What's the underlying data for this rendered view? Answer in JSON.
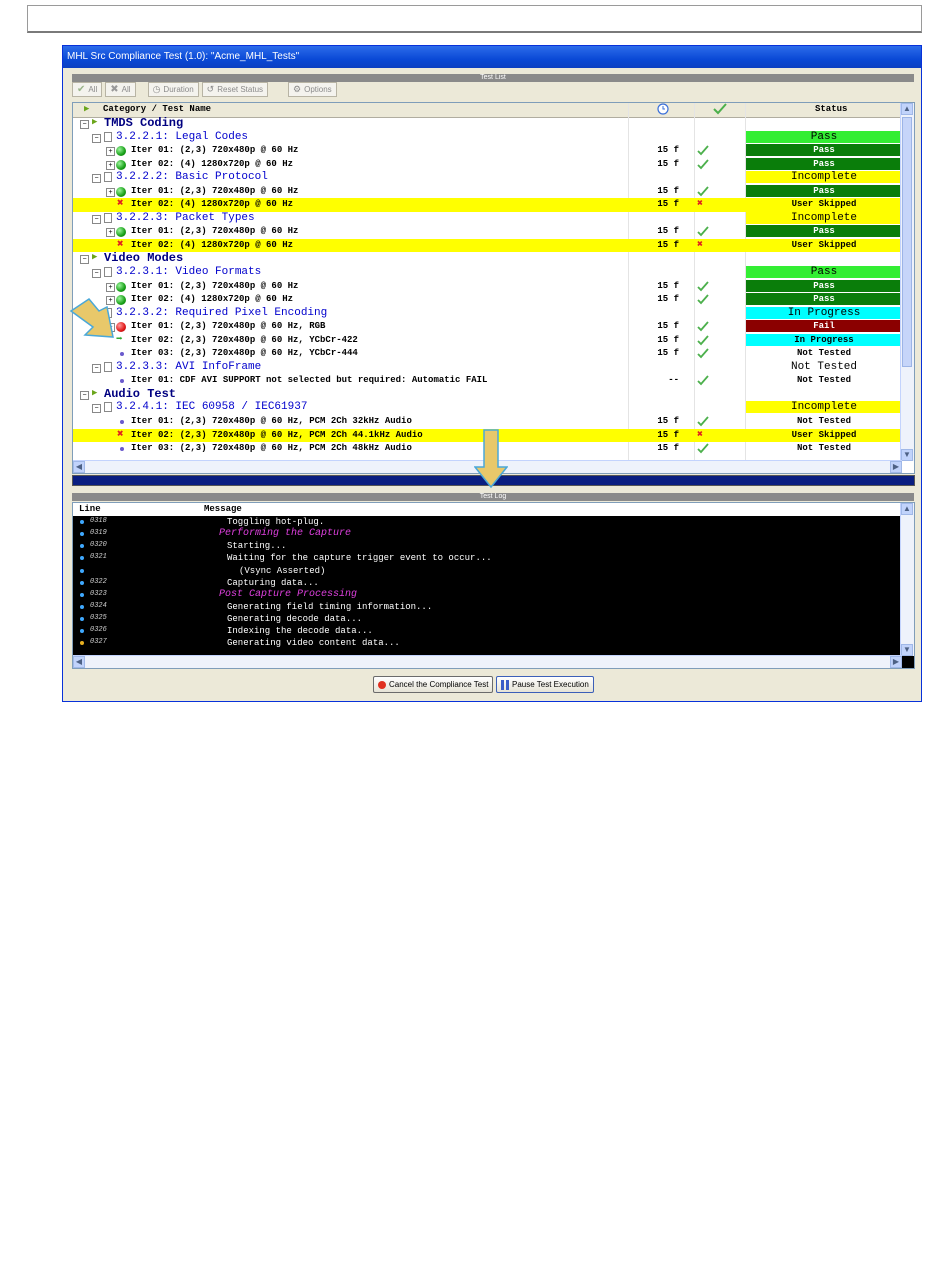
{
  "window": {
    "title": "MHL Src Compliance Test (1.0): \"Acme_MHL_Tests\"",
    "test_list_label": "Test List",
    "test_log_label": "Test Log"
  },
  "toolbar": {
    "check_all": "All",
    "uncheck_all": "All",
    "duration": "Duration",
    "reset_status": "Reset Status",
    "options": "Options"
  },
  "tree": {
    "header": {
      "name": "Category / Test Name",
      "status": "Status"
    },
    "rows": [
      {
        "kind": "cat",
        "name": "TMDS Coding",
        "dur": "",
        "check": "",
        "status": "",
        "status_color": "",
        "hl": false
      },
      {
        "kind": "grp",
        "name": "3.2.2.1: Legal Codes",
        "dur": "",
        "check": "",
        "status": "Pass",
        "status_color": "#33ee33",
        "hl": false
      },
      {
        "kind": "iter",
        "icon": "green",
        "name": "Iter 01: (2,3) 720x480p @ 60 Hz",
        "dur": "15 f",
        "check": "ok",
        "status": "Pass",
        "status_color": "#0a7d0a",
        "hl": false
      },
      {
        "kind": "iter",
        "icon": "green",
        "name": "Iter 02: (4) 1280x720p @ 60 Hz",
        "dur": "15 f",
        "check": "ok",
        "status": "Pass",
        "status_color": "#0a7d0a",
        "hl": false
      },
      {
        "kind": "grp",
        "name": "3.2.2.2: Basic Protocol",
        "dur": "",
        "check": "",
        "status": "Incomplete",
        "status_color": "#ffff00",
        "hl": false
      },
      {
        "kind": "iter",
        "icon": "green",
        "name": "Iter 01: (2,3) 720x480p @ 60 Hz",
        "dur": "15 f",
        "check": "ok",
        "status": "Pass",
        "status_color": "#0a7d0a",
        "hl": false
      },
      {
        "kind": "iter",
        "icon": "x",
        "name": "Iter 02: (4) 1280x720p @ 60 Hz",
        "dur": "15 f",
        "check": "x",
        "status": "User Skipped",
        "status_color": "#ffff00",
        "hl": true
      },
      {
        "kind": "grp",
        "name": "3.2.2.3: Packet Types",
        "dur": "",
        "check": "",
        "status": "Incomplete",
        "status_color": "#ffff00",
        "hl": false
      },
      {
        "kind": "iter",
        "icon": "green",
        "name": "Iter 01: (2,3) 720x480p @ 60 Hz",
        "dur": "15 f",
        "check": "ok",
        "status": "Pass",
        "status_color": "#0a7d0a",
        "hl": false
      },
      {
        "kind": "iter",
        "icon": "x",
        "name": "Iter 02: (4) 1280x720p @ 60 Hz",
        "dur": "15 f",
        "check": "x",
        "status": "User Skipped",
        "status_color": "#ffff00",
        "hl": true
      },
      {
        "kind": "cat",
        "name": "Video Modes",
        "dur": "",
        "check": "",
        "status": "",
        "status_color": "",
        "hl": false
      },
      {
        "kind": "grp",
        "name": "3.2.3.1: Video Formats",
        "dur": "",
        "check": "",
        "status": "Pass",
        "status_color": "#33ee33",
        "hl": false
      },
      {
        "kind": "iter",
        "icon": "green",
        "name": "Iter 01: (2,3) 720x480p @ 60 Hz",
        "dur": "15 f",
        "check": "ok",
        "status": "Pass",
        "status_color": "#0a7d0a",
        "hl": false
      },
      {
        "kind": "iter",
        "icon": "green",
        "name": "Iter 02: (4) 1280x720p @ 60 Hz",
        "dur": "15 f",
        "check": "ok",
        "status": "Pass",
        "status_color": "#0a7d0a",
        "hl": false
      },
      {
        "kind": "grp",
        "name": "3.2.3.2: Required Pixel Encoding",
        "dur": "",
        "check": "",
        "status": "In Progress",
        "status_color": "#00ffff",
        "hl": false
      },
      {
        "kind": "iter",
        "icon": "red",
        "name": "Iter 01: (2,3) 720x480p @ 60 Hz, RGB",
        "dur": "15 f",
        "check": "ok",
        "status": "Fail",
        "status_color": "#8b0000",
        "hl": false
      },
      {
        "kind": "iter",
        "icon": "play",
        "name": "Iter 02: (2,3) 720x480p @ 60 Hz, YCbCr-422",
        "dur": "15 f",
        "check": "ok",
        "status": "In Progress",
        "status_color": "#00ffff",
        "hl": false
      },
      {
        "kind": "iter",
        "icon": "dot",
        "name": "Iter 03: (2,3) 720x480p @ 60 Hz, YCbCr-444",
        "dur": "15 f",
        "check": "ok",
        "status": "Not Tested",
        "status_color": "",
        "hl": false
      },
      {
        "kind": "grp",
        "name": "3.2.3.3: AVI InfoFrame",
        "dur": "",
        "check": "",
        "status": "Not Tested",
        "status_color": "",
        "hl": false
      },
      {
        "kind": "iter",
        "icon": "dot",
        "name": "Iter 01: CDF AVI SUPPORT not selected but required: Automatic FAIL",
        "dur": "--",
        "check": "ok",
        "status": "Not Tested",
        "status_color": "",
        "hl": false
      },
      {
        "kind": "cat",
        "name": "Audio Test",
        "dur": "",
        "check": "",
        "status": "",
        "status_color": "",
        "hl": false
      },
      {
        "kind": "grp",
        "name": "3.2.4.1: IEC 60958 / IEC61937",
        "dur": "",
        "check": "",
        "status": "Incomplete",
        "status_color": "#ffff00",
        "hl": false
      },
      {
        "kind": "iter",
        "icon": "dot",
        "name": "Iter 01: (2,3) 720x480p @ 60 Hz, PCM 2Ch 32kHz Audio",
        "dur": "15 f",
        "check": "ok",
        "status": "Not Tested",
        "status_color": "",
        "hl": false
      },
      {
        "kind": "iter",
        "icon": "x",
        "name": "Iter 02: (2,3) 720x480p @ 60 Hz, PCM 2Ch 44.1kHz Audio",
        "dur": "15 f",
        "check": "x",
        "status": "User Skipped",
        "status_color": "#ffff00",
        "hl": true
      },
      {
        "kind": "iter",
        "icon": "dot",
        "name": "Iter 03: (2,3) 720x480p @ 60 Hz, PCM 2Ch 48kHz Audio",
        "dur": "15 f",
        "check": "ok",
        "status": "Not Tested",
        "status_color": "",
        "hl": false
      }
    ]
  },
  "log": {
    "header": {
      "line": "Line",
      "message": "Message"
    },
    "rows": [
      {
        "line": "0318",
        "msg": "Toggling hot-plug.",
        "style": "normal",
        "indent": 1
      },
      {
        "line": "0319",
        "msg": "Performing the Capture",
        "style": "pink",
        "indent": 0
      },
      {
        "line": "0320",
        "msg": "Starting...",
        "style": "normal",
        "indent": 1
      },
      {
        "line": "0321",
        "msg": "Waiting for the capture trigger event to occur...",
        "style": "normal",
        "indent": 1
      },
      {
        "line": "",
        "msg": "(Vsync Asserted)",
        "style": "normal",
        "indent": 2
      },
      {
        "line": "0322",
        "msg": "Capturing data...",
        "style": "normal",
        "indent": 1
      },
      {
        "line": "0323",
        "msg": "Post Capture Processing",
        "style": "pink",
        "indent": 0
      },
      {
        "line": "0324",
        "msg": "Generating field timing information...",
        "style": "normal",
        "indent": 1
      },
      {
        "line": "0325",
        "msg": "Generating decode data...",
        "style": "normal",
        "indent": 1
      },
      {
        "line": "0326",
        "msg": "Indexing the decode data...",
        "style": "normal",
        "indent": 1
      },
      {
        "line": "0327",
        "msg": "Generating video content data...",
        "style": "normal",
        "indent": 1
      }
    ]
  },
  "buttons": {
    "cancel": "Cancel the Compliance Test",
    "pause": "Pause Test Execution"
  }
}
